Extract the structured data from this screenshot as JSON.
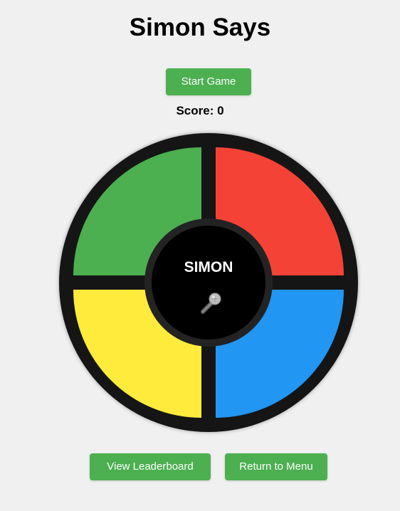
{
  "game": {
    "title": "Simon Says",
    "score_label": "Score: 0",
    "center_label": "SIMON",
    "mic_icon": "microphone-icon"
  },
  "buttons": {
    "start": "Start Game",
    "leaderboard": "View Leaderboard",
    "menu": "Return to Menu"
  },
  "colors": {
    "background": "#f0f0f0",
    "button": "#4caf50",
    "board_ring": "#151515",
    "green": "#4caf50",
    "red": "#f44336",
    "yellow": "#ffeb3b",
    "blue": "#2196f3"
  }
}
